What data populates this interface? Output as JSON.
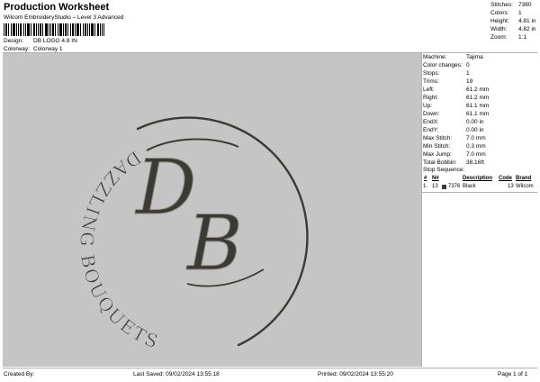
{
  "header": {
    "title": "Production Worksheet",
    "subtitle": "Wilcom EmbroideryStudio – Level 3 Advanced"
  },
  "design_info": [
    {
      "label": "Design:",
      "value": "DB LOGO 4.8 IN"
    },
    {
      "label": "Colorway:",
      "value": "Colorway 1"
    }
  ],
  "summary": [
    {
      "label": "Stitches:",
      "value": "7380"
    },
    {
      "label": "Colors:",
      "value": "1"
    },
    {
      "label": "Height:",
      "value": "4.81 in"
    },
    {
      "label": "Width:",
      "value": "4.82 in"
    },
    {
      "label": "Zoom:",
      "value": "1:1"
    }
  ],
  "artwork": {
    "monogram_1": "D",
    "monogram_2": "B",
    "arc_text": "DAZZLING BOUQUETS",
    "thread_color": "#3b3a35",
    "background_color": "#c5c5c5"
  },
  "machine_info": [
    {
      "label": "Machine:",
      "value": "Tajima"
    },
    {
      "label": "Color changes:",
      "value": "0"
    },
    {
      "label": "Stops:",
      "value": "1"
    },
    {
      "label": "Trims:",
      "value": "19"
    },
    {
      "label": "Left:",
      "value": "61.2 mm"
    },
    {
      "label": "Right:",
      "value": "61.2 mm"
    },
    {
      "label": "Up:",
      "value": "61.1 mm"
    },
    {
      "label": "Down:",
      "value": "61.1 mm"
    },
    {
      "label": "EndX:",
      "value": "0.00 in"
    },
    {
      "label": "EndY:",
      "value": "0.00 in"
    },
    {
      "label": "Max Stitch:",
      "value": "7.0 mm"
    },
    {
      "label": "Min Stitch:",
      "value": "0.3 mm"
    },
    {
      "label": "Max Jump:",
      "value": "7.0 mm"
    },
    {
      "label": "Total Bobbin:",
      "value": "38.16ft"
    }
  ],
  "stop_sequence": {
    "title": "Stop Sequence:",
    "columns": [
      "#",
      "N#",
      "Description",
      "Code",
      "Brand"
    ],
    "rows": [
      {
        "index": "1.",
        "stop": "13",
        "n": "7376",
        "description": "Black",
        "code": "13",
        "brand": "Wilcom",
        "swatch_color": "#3a3a3a"
      }
    ]
  },
  "footer": {
    "created_by": "Created By:",
    "last_saved": "Last Saved: 09/02/2024 13:55:18",
    "printed": "Printed: 09/02/2024 13:55:20",
    "page": "Page 1 of 1"
  }
}
